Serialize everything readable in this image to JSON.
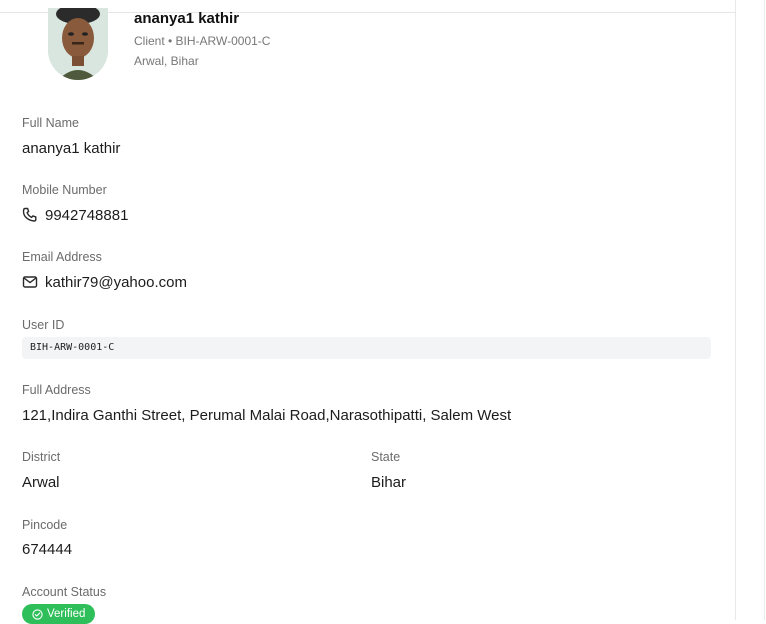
{
  "profile": {
    "name": "ananya1 kathir",
    "subtitle": "Client • BIH-ARW-0001-C",
    "location": "Arwal, Bihar"
  },
  "fields": {
    "full_name": {
      "label": "Full Name",
      "value": "ananya1 kathir"
    },
    "mobile": {
      "label": "Mobile Number",
      "value": "9942748881",
      "icon": "phone-icon"
    },
    "email": {
      "label": "Email Address",
      "value": "kathir79@yahoo.com",
      "icon": "mail-icon"
    },
    "user_id": {
      "label": "User ID",
      "value": "BIH-ARW-0001-C"
    },
    "address": {
      "label": "Full Address",
      "value": "121,Indira Ganthi Street, Perumal Malai Road,Narasothipatti, Salem West"
    },
    "district": {
      "label": "District",
      "value": "Arwal"
    },
    "state": {
      "label": "State",
      "value": "Bihar"
    },
    "pincode": {
      "label": "Pincode",
      "value": "674444"
    },
    "account_status": {
      "label": "Account Status",
      "value": "Verified",
      "color": "#2fbf5a",
      "icon": "check-circle-icon"
    }
  }
}
